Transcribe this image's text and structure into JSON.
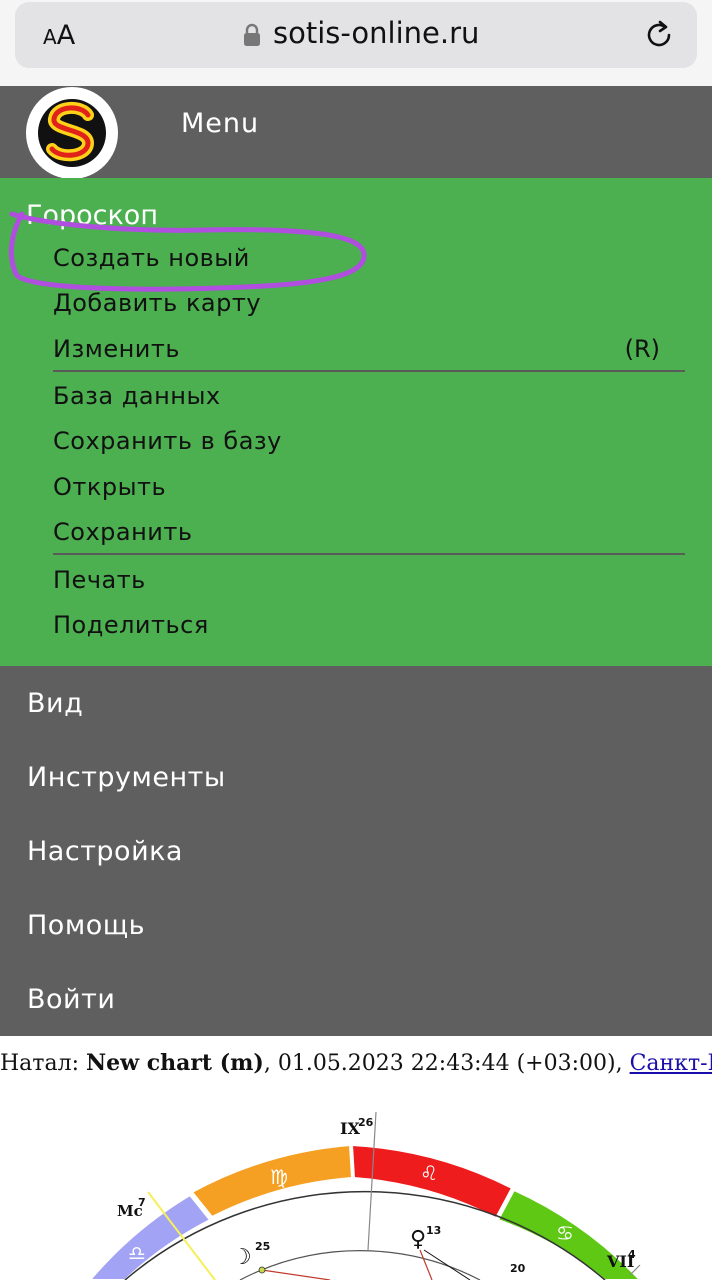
{
  "browser": {
    "text_size_small": "A",
    "text_size_big": "A",
    "url": "sotis-online.ru"
  },
  "header": {
    "menu_label": "Menu"
  },
  "horoscope_menu": {
    "title": "Гороскоп",
    "items": [
      {
        "label": "Создать новый"
      },
      {
        "label": "Добавить карту"
      },
      {
        "label": "Изменить",
        "shortcut": "(R)"
      },
      {
        "label": "База данных"
      },
      {
        "label": "Сохранить в базу"
      },
      {
        "label": "Открыть"
      },
      {
        "label": "Сохранить"
      },
      {
        "label": "Печать"
      },
      {
        "label": "Поделиться"
      }
    ]
  },
  "main_menu": [
    {
      "label": "Вид"
    },
    {
      "label": "Инструменты"
    },
    {
      "label": "Настройка"
    },
    {
      "label": "Помощь"
    },
    {
      "label": "Войти"
    }
  ],
  "natal_line": {
    "prefix": "Натал: ",
    "chart_name": "New chart (m)",
    "datetime": ", 01.05.2023 22:43:44 (+03:00), ",
    "place_link": "Санкт-Пет",
    "ellipsis": "…"
  },
  "chart_labels": {
    "ix": "IX",
    "ix_deg": "26",
    "mc": "Mc",
    "mc_deg": "7",
    "vii": "VII",
    "vii_deg": "4",
    "moon_deg": "25",
    "venus_deg": "13",
    "other_deg": "20"
  },
  "colors": {
    "green_panel": "#4caf50",
    "dark_panel": "#5f5f5f",
    "highlight_ring": "#b04ee0",
    "sign_orange": "#f5a023",
    "sign_red": "#ee1c1c",
    "sign_green": "#5ec814",
    "sign_violet": "#a3a3f5"
  },
  "icons": {
    "lock": "lock-icon",
    "reload": "reload-icon",
    "logo": "sotis-logo"
  }
}
